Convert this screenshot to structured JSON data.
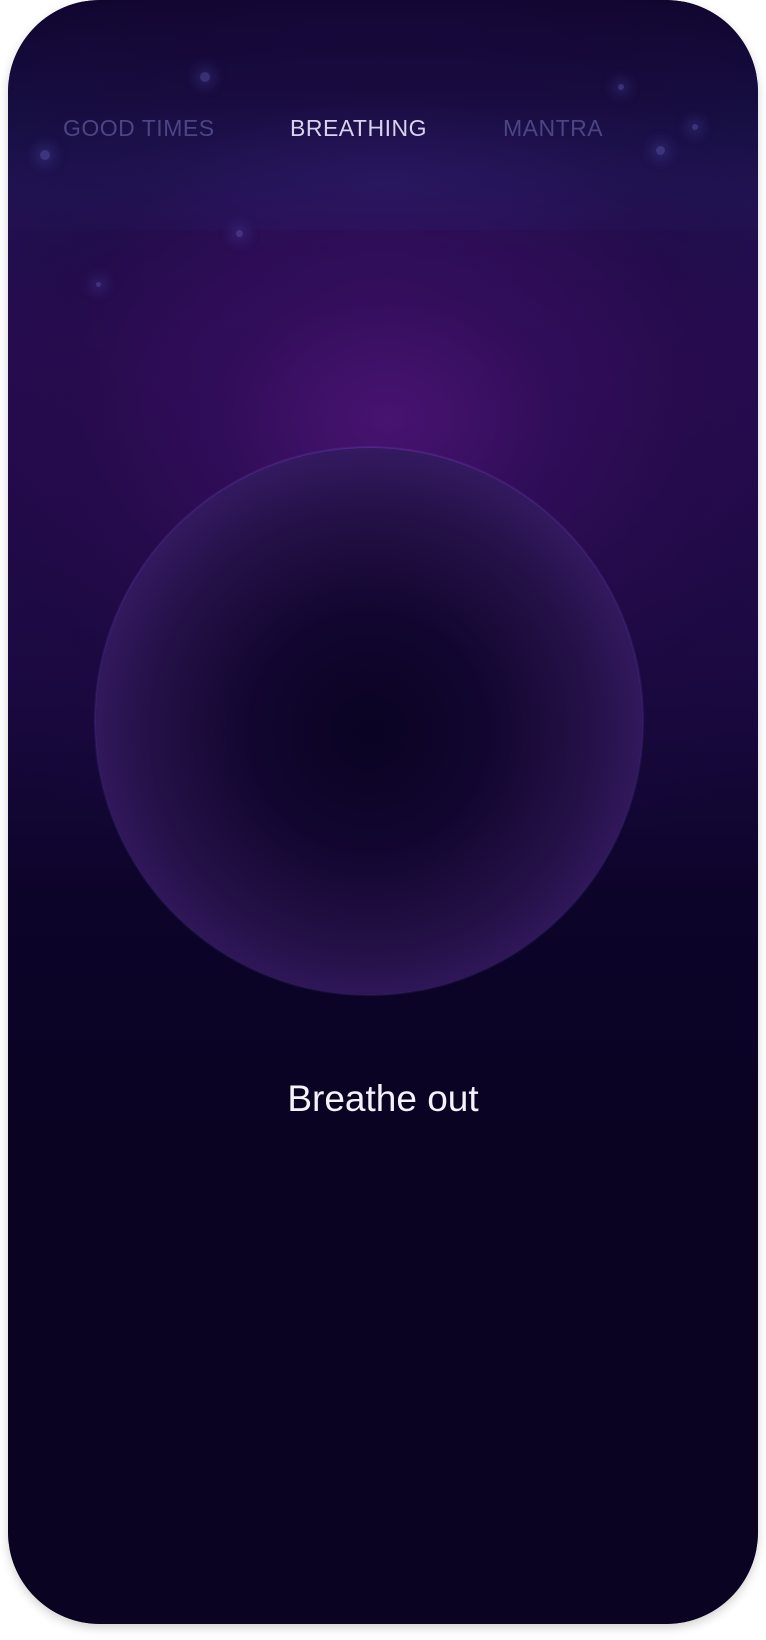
{
  "tabs": [
    {
      "label": "GOOD TIMES",
      "active": false
    },
    {
      "label": "BREATHING",
      "active": true
    },
    {
      "label": "MANTRA",
      "active": false
    }
  ],
  "breathing": {
    "instruction": "Breathe out"
  },
  "colors": {
    "background": "#0a0322",
    "orb_rim": "#6a44b8",
    "tab_active": "#d8d2ef",
    "tab_inactive": "#4b4585"
  }
}
